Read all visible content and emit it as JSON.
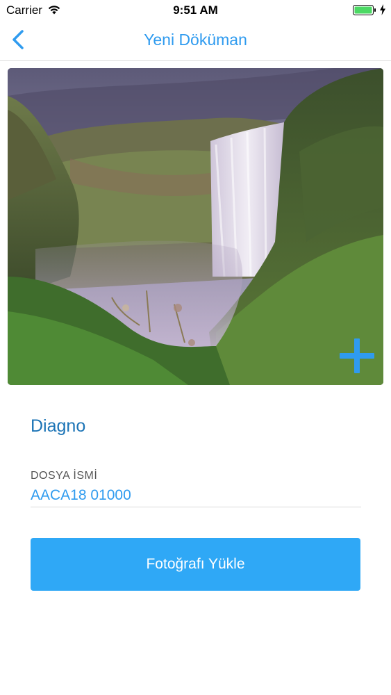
{
  "status_bar": {
    "carrier": "Carrier",
    "time": "9:51 AM",
    "wifi_icon": "wifi-icon",
    "battery_icon": "battery-icon",
    "charging_icon": "bolt-icon",
    "battery_color": "#4cd964"
  },
  "nav": {
    "title": "Yeni Döküman",
    "back_icon": "chevron-left-icon",
    "accent": "#2f9bef"
  },
  "photo": {
    "description_icon": "landscape-photo",
    "add_icon": "plus-icon"
  },
  "document": {
    "title": "Diagno",
    "file_name_label": "DOSYA İSMİ",
    "file_name_value": "AACA18 01000"
  },
  "actions": {
    "upload_label": "Fotoğrafı Yükle",
    "upload_color": "#2fa8f6"
  }
}
